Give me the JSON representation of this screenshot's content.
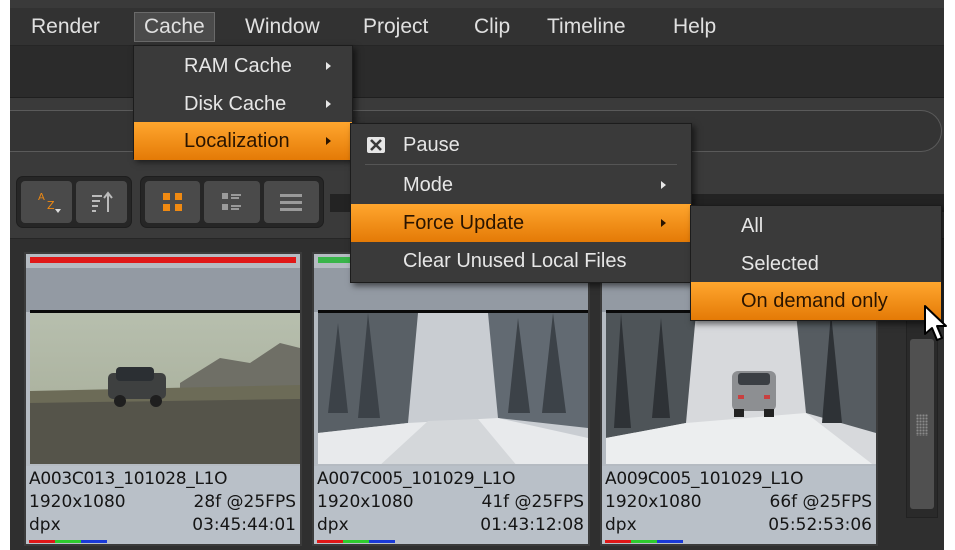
{
  "menubar": {
    "items": [
      "Render",
      "Cache",
      "Window",
      "Project",
      "Clip",
      "Timeline",
      "Help"
    ],
    "active": "Cache"
  },
  "cache_menu": {
    "items": [
      {
        "label": "RAM Cache",
        "submenu": true
      },
      {
        "label": "Disk Cache",
        "submenu": true
      },
      {
        "label": "Localization",
        "submenu": true,
        "highlighted": true
      }
    ]
  },
  "localization_menu": {
    "pause_label": "Pause",
    "mode_label": "Mode",
    "force_update_label": "Force Update",
    "clear_unused_label": "Clear Unused Local Files"
  },
  "force_update_menu": {
    "items": [
      "All",
      "Selected",
      "On demand only"
    ],
    "highlighted": "On demand only"
  },
  "toolbar": {
    "sort_icon": "sort-az-icon",
    "sort_order_icon": "sort-order-icon",
    "view_modes": [
      "thumbnail-view-icon",
      "detail-view-icon",
      "list-view-icon"
    ]
  },
  "clips": [
    {
      "name": "A003C013_101028_L1O",
      "resolution": "1920x1080",
      "frames": "28f @25FPS",
      "format": "dpx",
      "timecode": "03:45:44:01",
      "status_color": "#e01818"
    },
    {
      "name": "A007C005_101029_L1O",
      "resolution": "1920x1080",
      "frames": "41f @25FPS",
      "format": "dpx",
      "timecode": "01:43:12:08",
      "status_color": "#39b54a"
    },
    {
      "name": "A009C005_101029_L1O",
      "resolution": "1920x1080",
      "frames": "66f @25FPS",
      "format": "dpx",
      "timecode": "05:52:53:06",
      "status_color": "#39b54a"
    }
  ],
  "colors": {
    "accent": "#f08a12",
    "background": "#3a3a3a",
    "channel_red": "#e01818",
    "channel_green": "#2ecc2e",
    "channel_blue": "#1a3ad8"
  }
}
